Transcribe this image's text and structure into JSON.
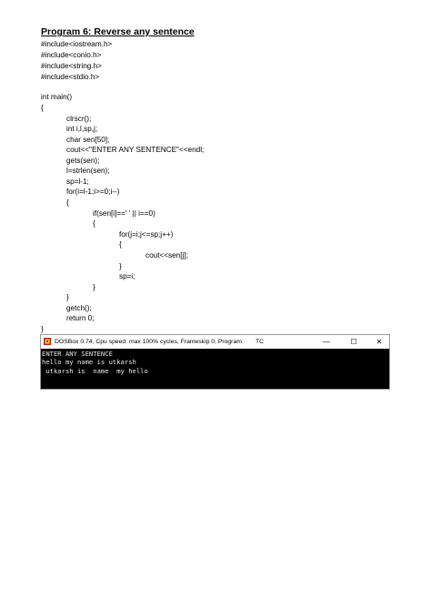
{
  "heading": "Program 6: Reverse any sentence",
  "code_lines": [
    "#include<iostream.h>",
    "#include<conio.h>",
    "#include<string.h>",
    "#include<stdio.h>",
    "int main()",
    "{",
    "clrscr();",
    "int i,l,sp,j;",
    "char sen[50];",
    "cout<<\"ENTER ANY SENTENCE\"<<endl;",
    "gets(sen);",
    "l=strlen(sen);",
    "sp=l-1;",
    "for(i=l-1;i>=0;i--)",
    "{",
    "if(sen[i]==' ' || i==0)",
    "{",
    "for(j=i;j<=sp;j++)",
    "{",
    "cout<<sen[j];",
    "}",
    "sp=i;",
    "}",
    "}",
    "getch();",
    "return 0;",
    "}"
  ],
  "dosbox": {
    "title": "DOSBox 0.74, Cpu speed: max 100% cycles, Frameskip  0, Program:",
    "program": "TC",
    "buttons": {
      "minimize": "—",
      "maximize": "☐",
      "close": "✕"
    },
    "output_lines": [
      "ENTER ANY SENTENCE",
      "hello my name is utkarsh",
      " utkarsh is  name  my hello"
    ]
  }
}
